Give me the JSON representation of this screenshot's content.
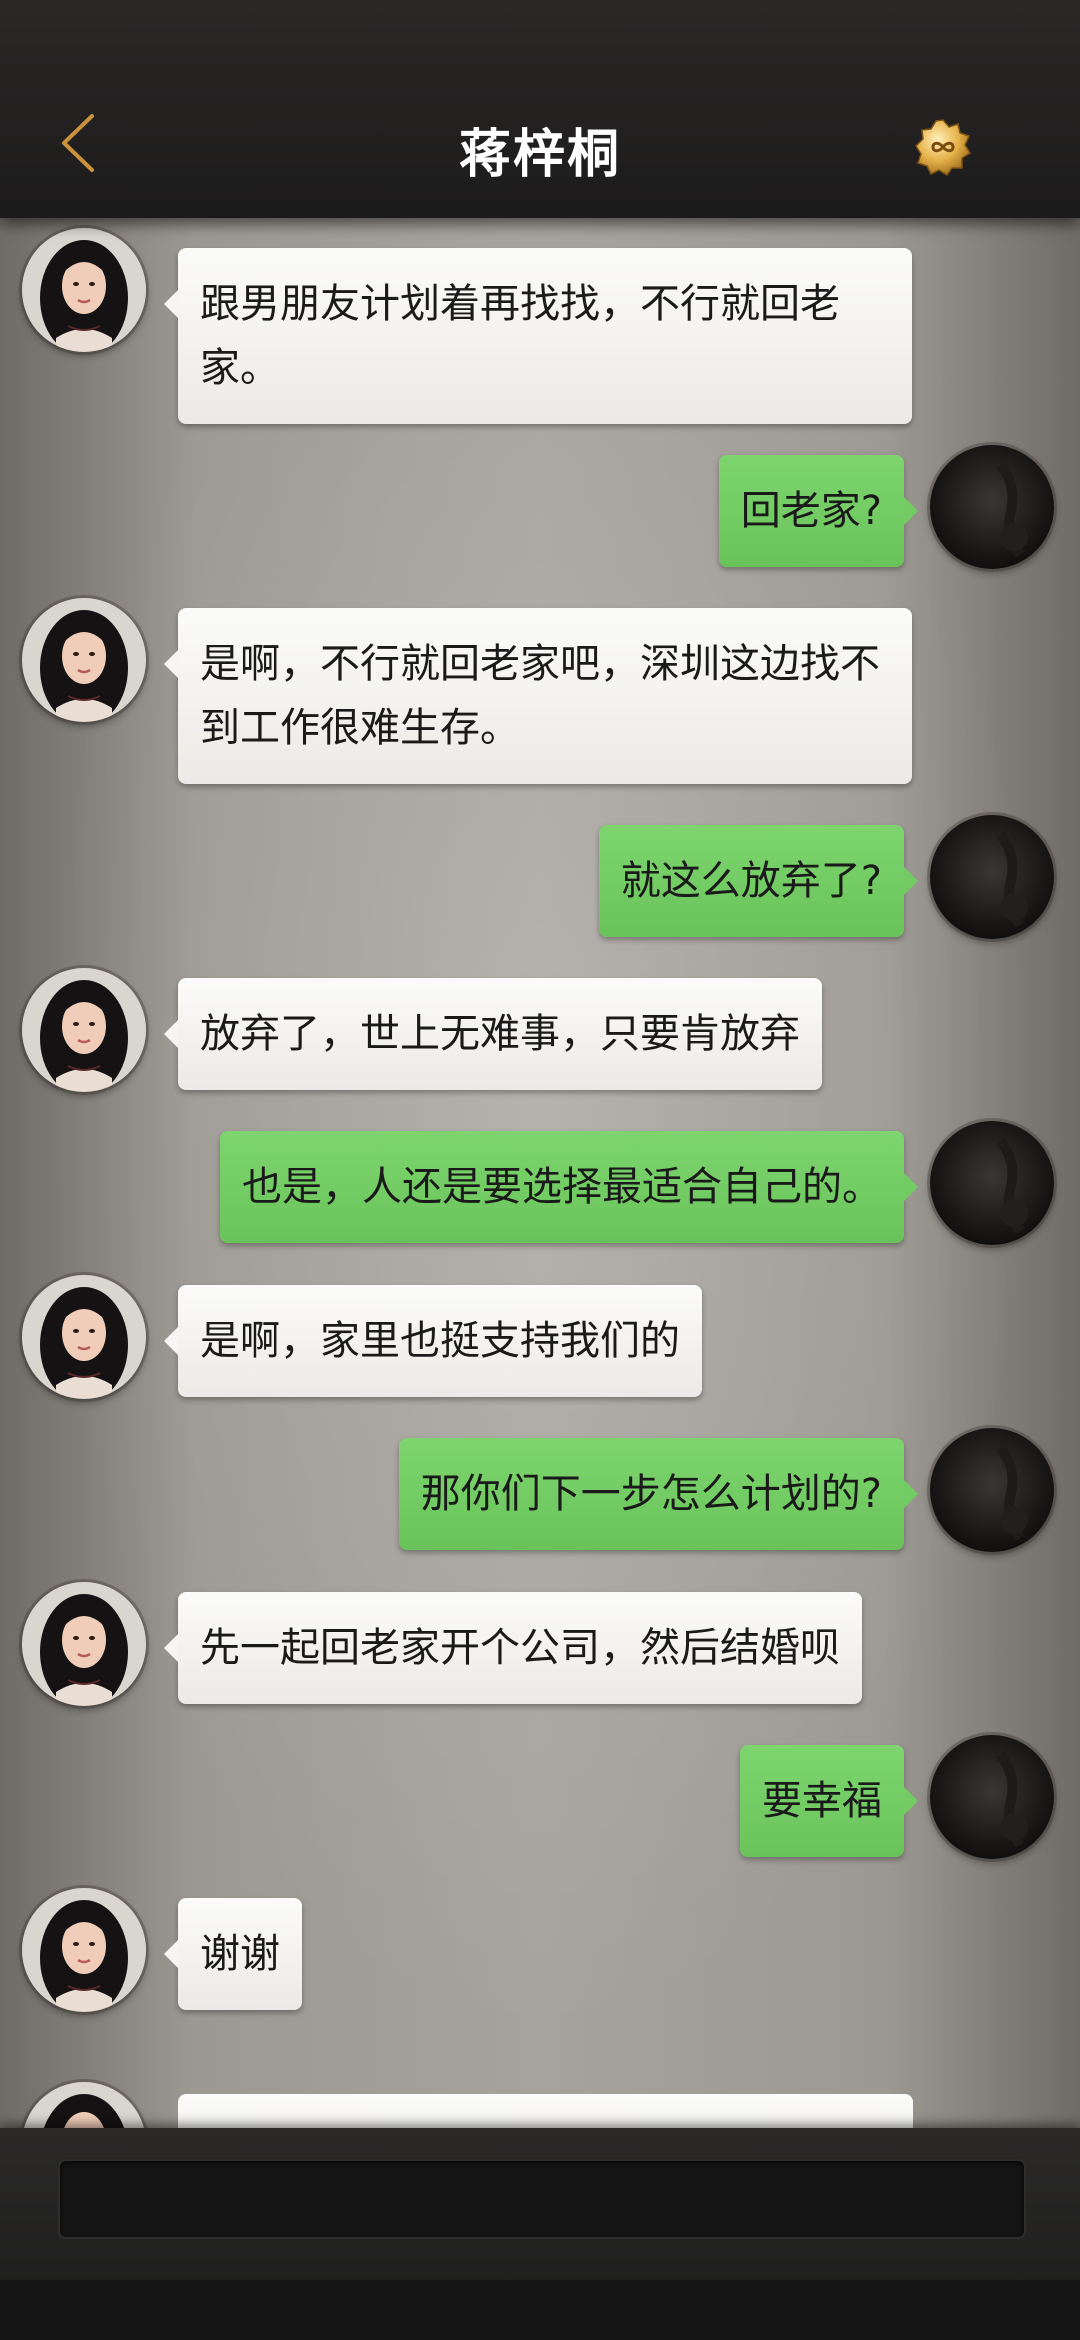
{
  "header": {
    "title": "蒋梓桐",
    "back_icon": "chevron-left-icon",
    "badge_icon": "infinity-coin-icon",
    "accent_color": "#c8913a"
  },
  "messages": [
    {
      "side": "left",
      "text": "跟男朋友计划着再找找，不行就回老家。"
    },
    {
      "side": "right",
      "text": "回老家?"
    },
    {
      "side": "left",
      "text": "是啊，不行就回老家吧，深圳这边找不到工作很难生存。"
    },
    {
      "side": "right",
      "text": "就这么放弃了?"
    },
    {
      "side": "left",
      "text": "放弃了，世上无难事，只要肯放弃"
    },
    {
      "side": "right",
      "text": "也是，人还是要选择最适合自己的。"
    },
    {
      "side": "left",
      "text": "是啊，家里也挺支持我们的"
    },
    {
      "side": "right",
      "text": "那你们下一步怎么计划的?"
    },
    {
      "side": "left",
      "text": "先一起回老家开个公司，然后结婚呗"
    },
    {
      "side": "right",
      "text": "要幸福"
    },
    {
      "side": "left",
      "text": "谢谢"
    }
  ],
  "colors": {
    "incoming_bubble": "#f4f3f1",
    "outgoing_bubble": "#72cb63",
    "header_bg": "#222120"
  }
}
